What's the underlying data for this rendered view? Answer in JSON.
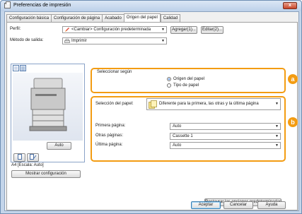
{
  "window": {
    "title": "Preferencias de impresión",
    "close_label": "x"
  },
  "tabs": [
    {
      "label": "Configuración básica"
    },
    {
      "label": "Configuración de página"
    },
    {
      "label": "Acabado"
    },
    {
      "label": "Origen del papel"
    },
    {
      "label": "Calidad"
    }
  ],
  "profile": {
    "label": "Perfil:",
    "value": "<Cambiar> Configuración predeterminada",
    "add_label": "Agregar(1)...",
    "edit_label": "Editar(2)..."
  },
  "output": {
    "label": "Método de salida:",
    "value": "Imprimir"
  },
  "preview": {
    "auto_label": "Auto",
    "scale_text": "A4 [Escala: Auto]",
    "show_config_label": "Mostrar configuración"
  },
  "select_by": {
    "legend": "Seleccionar según",
    "options": [
      {
        "label": "Origen del papel",
        "checked": true
      },
      {
        "label": "Tipo de papel",
        "checked": false
      }
    ]
  },
  "paper_selection": {
    "label": "Selección del papel:",
    "value": "Diferente para la primera, las otras y la última página"
  },
  "pages": {
    "first_label": "Primera página:",
    "first_value": "Auto",
    "other_label": "Otras páginas:",
    "other_value": "Cassette 1",
    "last_label": "Última página:",
    "last_value": "Auto"
  },
  "callouts": {
    "a": "a",
    "b": "b"
  },
  "buttons": {
    "restore_defaults": "Restaurar las opciones predeterminadas",
    "accept": "Aceptar",
    "cancel": "Cancelar",
    "help": "Ayuda"
  },
  "colors": {
    "callout": "#f39c12",
    "title_bar": "#c4d5ea"
  }
}
